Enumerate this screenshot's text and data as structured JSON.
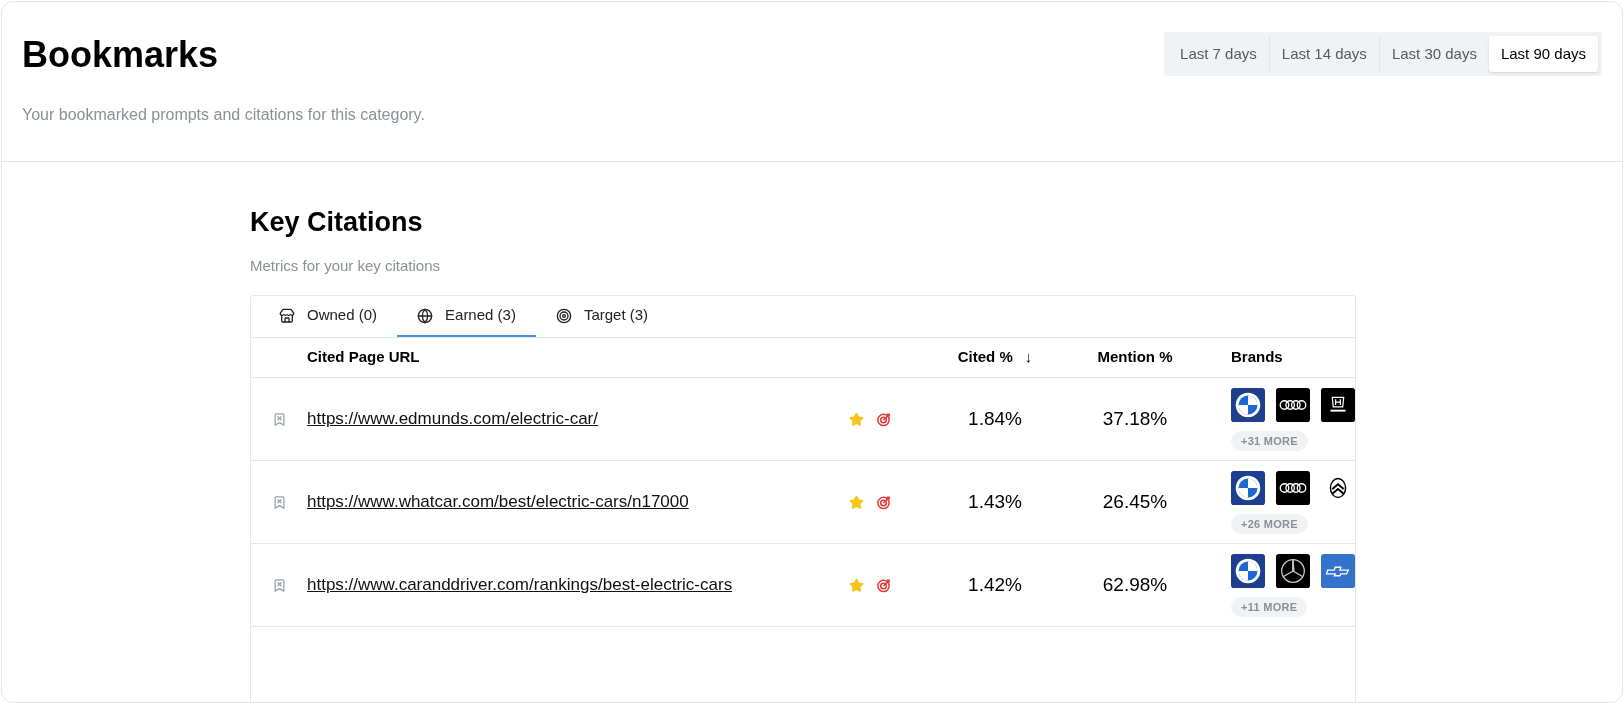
{
  "header": {
    "title": "Bookmarks",
    "subtitle": "Your bookmarked prompts and citations for this category."
  },
  "ranges": [
    {
      "label": "Last 7 days",
      "selected": false
    },
    {
      "label": "Last 14 days",
      "selected": false
    },
    {
      "label": "Last 30 days",
      "selected": false
    },
    {
      "label": "Last 90 days",
      "selected": true
    }
  ],
  "section": {
    "title": "Key Citations",
    "subtitle": "Metrics for your key citations"
  },
  "tabs": [
    {
      "label": "Owned (0)",
      "kind": "store",
      "selected": false
    },
    {
      "label": "Earned (3)",
      "kind": "globe",
      "selected": true
    },
    {
      "label": "Target (3)",
      "kind": "target",
      "selected": false
    }
  ],
  "table": {
    "columns": [
      "Cited Page URL",
      "Cited %",
      "Mention %",
      "Brands"
    ],
    "sort_arrow": "↓",
    "rows": [
      {
        "url": "https://www.edmunds.com/electric-car/",
        "cited": "1.84%",
        "mention": "37.18%",
        "brands": [
          {
            "kind": "bmw"
          },
          {
            "kind": "audi"
          },
          {
            "kind": "honda"
          }
        ],
        "more": "+31 MORE"
      },
      {
        "url": "https://www.whatcar.com/best/electric-cars/n17000",
        "cited": "1.43%",
        "mention": "26.45%",
        "brands": [
          {
            "kind": "bmw"
          },
          {
            "kind": "audi"
          },
          {
            "kind": "citroen"
          }
        ],
        "more": "+26 MORE"
      },
      {
        "url": "https://www.caranddriver.com/rankings/best-electric-cars",
        "cited": "1.42%",
        "mention": "62.98%",
        "brands": [
          {
            "kind": "bmw"
          },
          {
            "kind": "mercedes"
          },
          {
            "kind": "chevrolet"
          }
        ],
        "more": "+11 MORE"
      }
    ]
  }
}
